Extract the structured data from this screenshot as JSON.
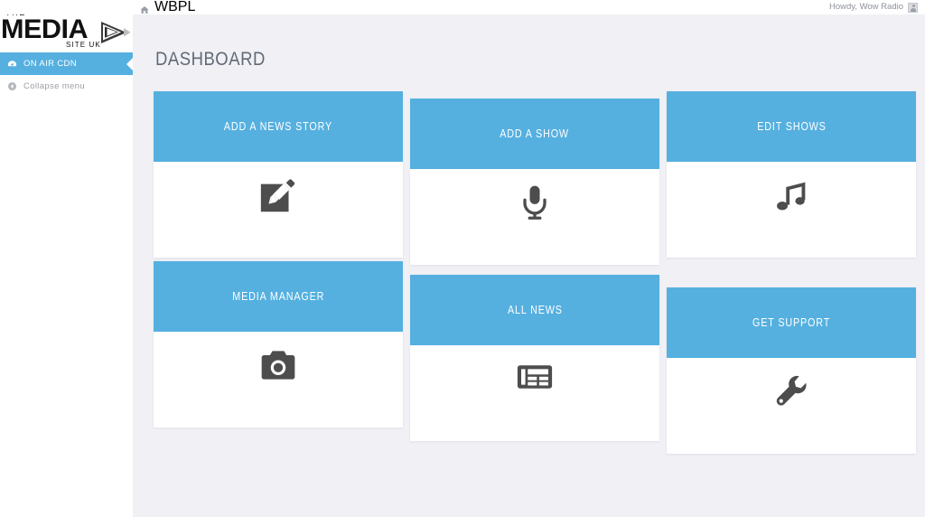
{
  "topbar": {
    "home_icon": "home-icon",
    "site_name": "WBPL",
    "user_greeting": "Howdy, Wow Radio",
    "avatar_icon": "avatar-icon"
  },
  "sidebar": {
    "logo": {
      "line_top": "THE",
      "line_main": "MEDIA",
      "line_bottom": "SITE UK",
      "mark_icon": "play-triangle-icon"
    },
    "items": [
      {
        "label": "ON AIR CDN",
        "icon": "dashboard-gauge-icon",
        "active": true
      },
      {
        "label": "Collapse menu",
        "icon": "collapse-left-arrow-icon",
        "active": false
      }
    ]
  },
  "main": {
    "page_title": "DASHBOARD",
    "cards": [
      {
        "title": "ADD A NEWS STORY",
        "icon": "edit-pencil-square-icon"
      },
      {
        "title": "ADD A SHOW",
        "icon": "microphone-icon"
      },
      {
        "title": "EDIT SHOWS",
        "icon": "music-note-icon"
      },
      {
        "title": "MEDIA MANAGER",
        "icon": "camera-icon"
      },
      {
        "title": "ALL NEWS",
        "icon": "newspaper-icon"
      },
      {
        "title": "GET SUPPORT",
        "icon": "wrench-icon"
      }
    ]
  },
  "colors": {
    "accent_blue": "#55b0e0",
    "page_background": "#f0f0f5",
    "card_background": "#ffffff",
    "title_gray": "#606a76",
    "icon_dark": "#4d4d4d",
    "muted_text": "#9b9ea4"
  }
}
